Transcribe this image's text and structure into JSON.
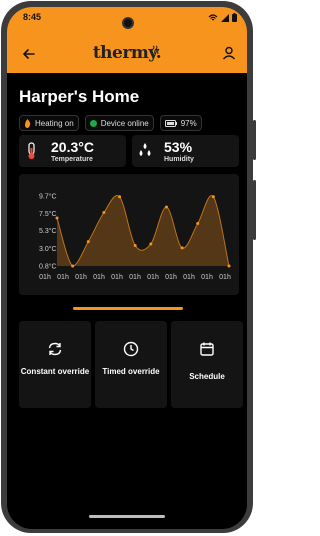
{
  "status_bar": {
    "time": "8:45"
  },
  "app_bar": {
    "brand": "thermy."
  },
  "home": {
    "title": "Harper's Home",
    "chips": [
      {
        "label": "Heating on",
        "icon": "flame-icon"
      },
      {
        "label": "Device online",
        "icon": "green-dot",
        "color": "#1ea84a"
      },
      {
        "label": "97%",
        "icon": "battery-icon"
      }
    ]
  },
  "metrics": [
    {
      "value": "20.3°C",
      "label": "Temperature",
      "icon": "thermometer-icon"
    },
    {
      "value": "53%",
      "label": "Humidity",
      "icon": "droplets-icon"
    }
  ],
  "chart_data": {
    "type": "area",
    "y_ticks": [
      "9.7°C",
      "7.5°C",
      "5.3°C",
      "3.0°C",
      "0.8°C"
    ],
    "x_ticks": [
      "01h",
      "01h",
      "01h",
      "01h",
      "01h",
      "01h",
      "01h",
      "01h",
      "01h",
      "01h",
      "01h"
    ],
    "ylim": [
      0.8,
      9.7
    ],
    "points": [
      6.9,
      0.8,
      3.9,
      7.6,
      9.6,
      3.4,
      3.6,
      8.3,
      3.1,
      6.2,
      9.6,
      0.8
    ],
    "accent": "#f7941d"
  },
  "actions": [
    {
      "label": "Constant override",
      "icon": "refresh-icon"
    },
    {
      "label": "Timed override",
      "icon": "clock-icon"
    },
    {
      "label": "Schedule",
      "icon": "calendar-icon"
    }
  ],
  "colors": {
    "accent": "#f7941d",
    "card": "#141414",
    "background": "#000000"
  }
}
